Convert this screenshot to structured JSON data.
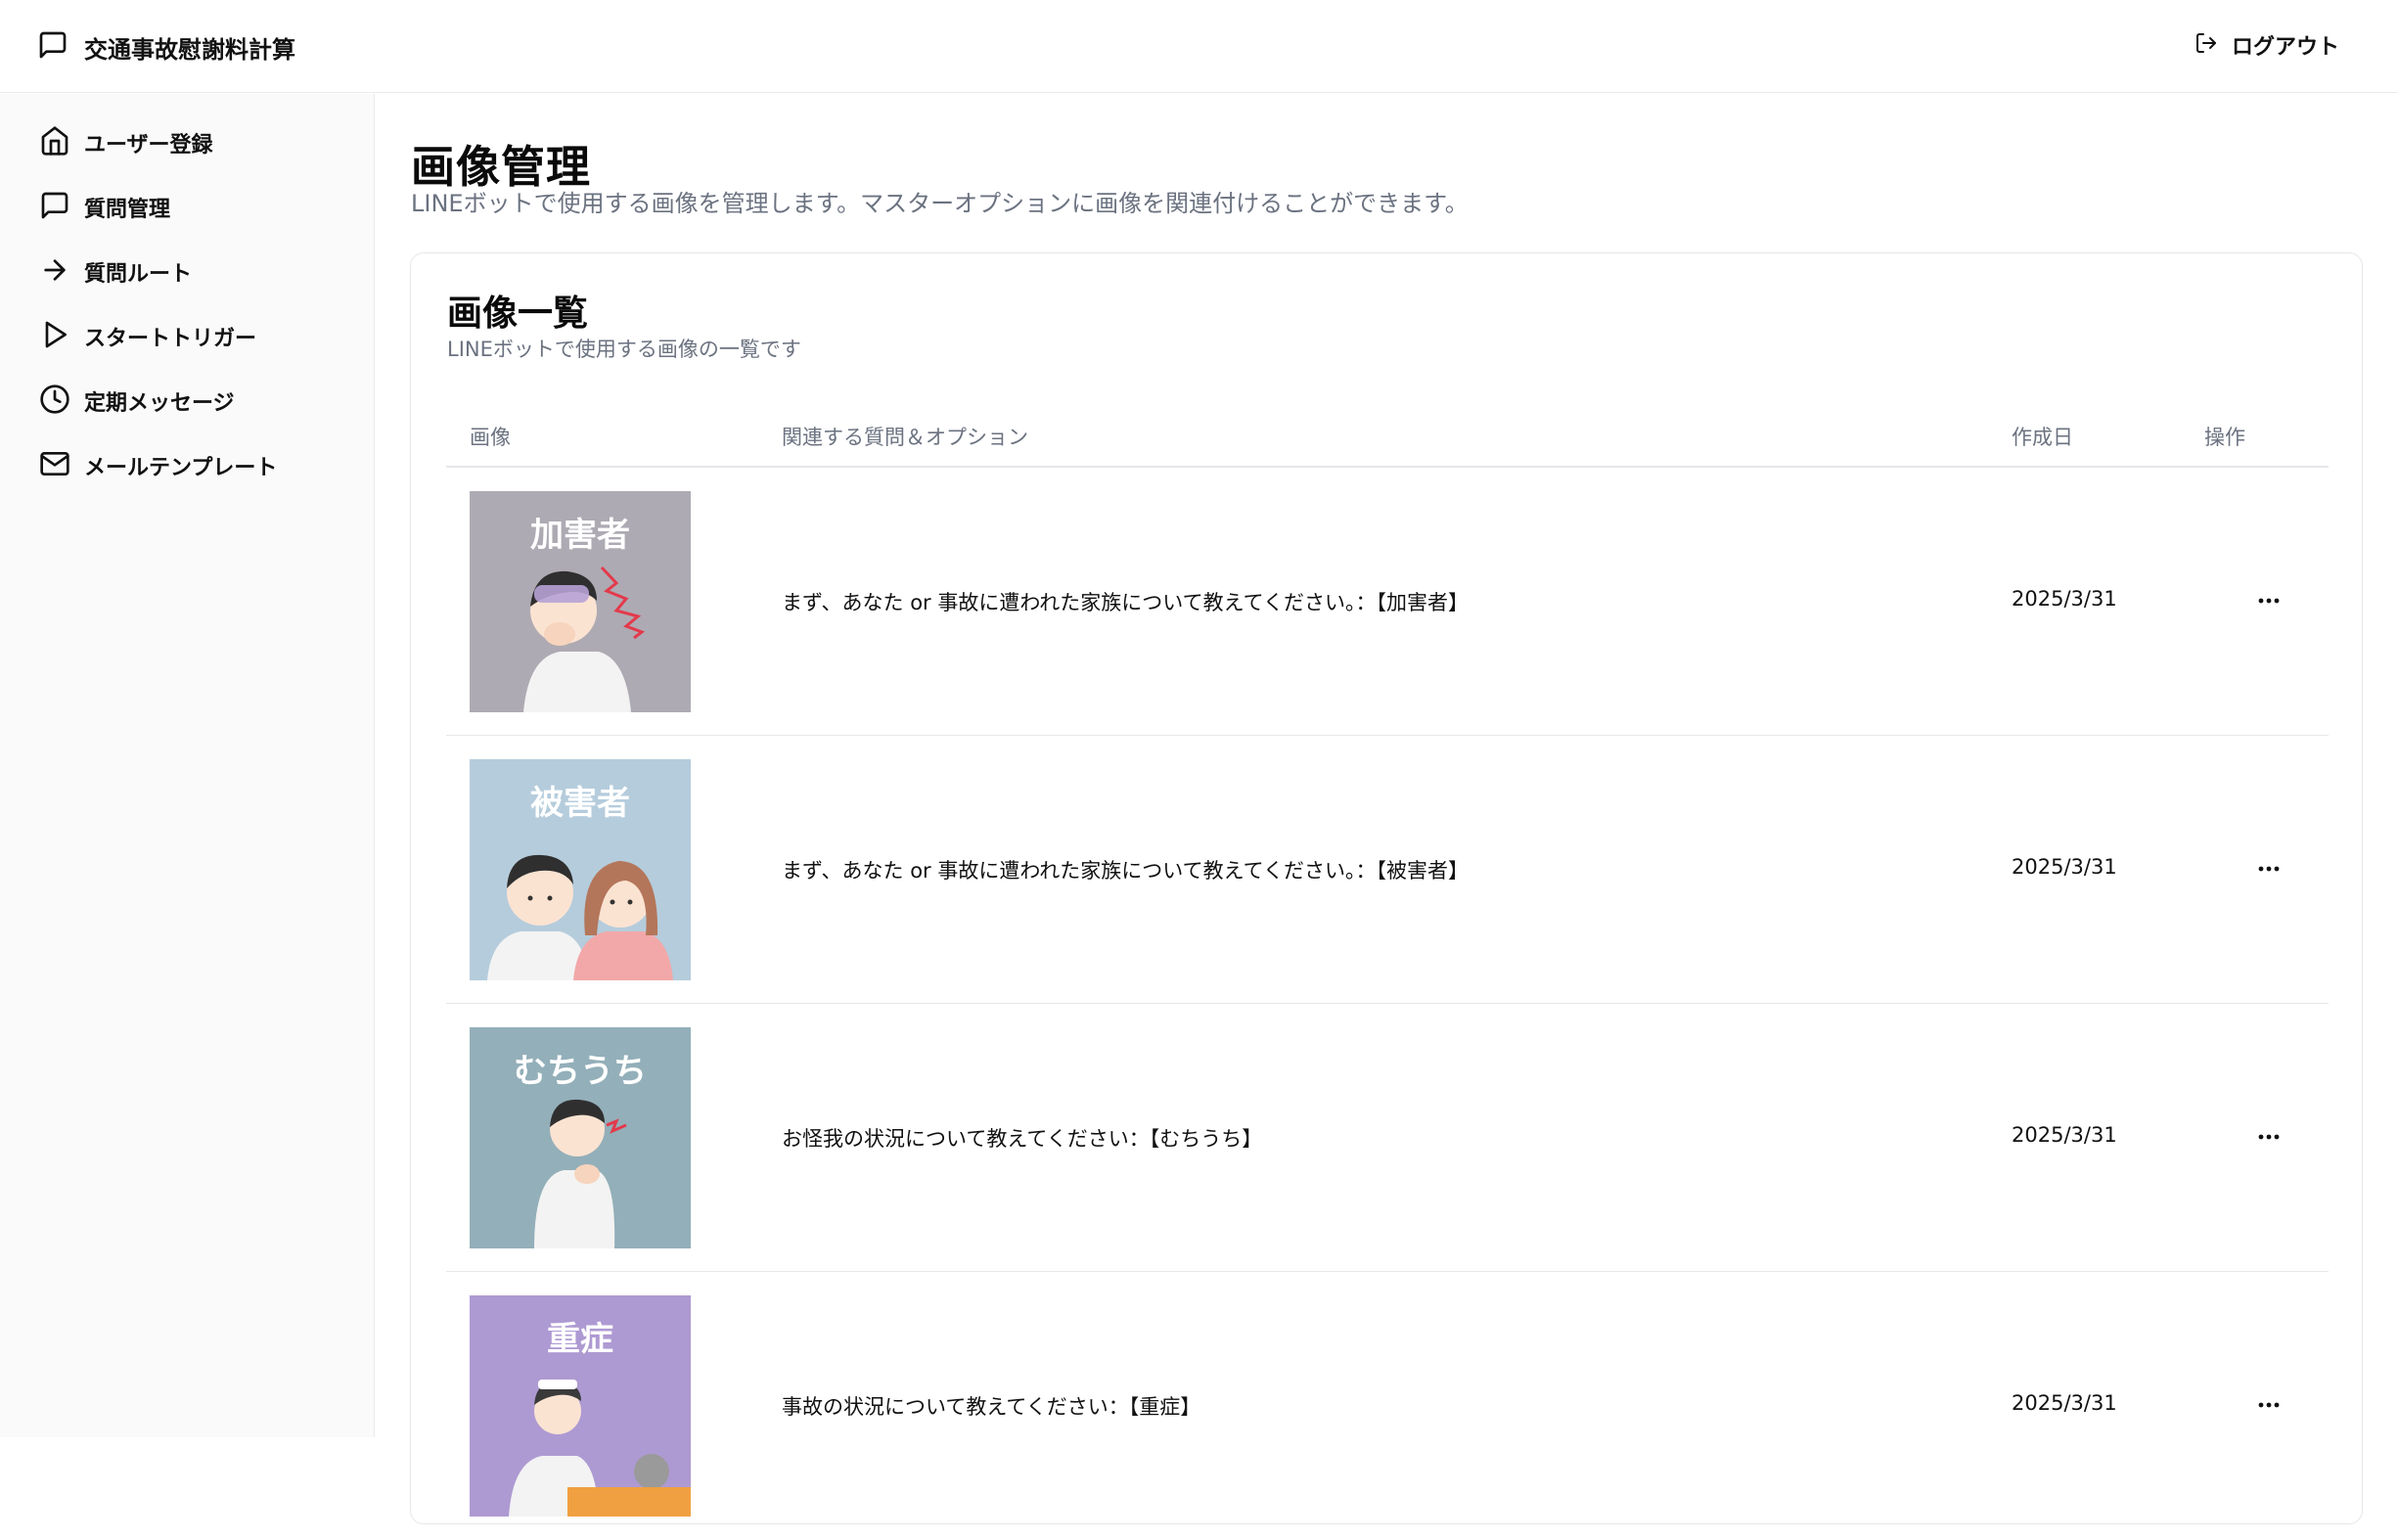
{
  "header": {
    "app_title": "交通事故慰謝料計算",
    "logout_label": "ログアウト"
  },
  "sidebar": {
    "items": [
      {
        "label": "ユーザー登録",
        "icon": "home-icon"
      },
      {
        "label": "質問管理",
        "icon": "message-square-icon"
      },
      {
        "label": "質問ルート",
        "icon": "arrow-right-icon"
      },
      {
        "label": "スタートトリガー",
        "icon": "play-icon"
      },
      {
        "label": "定期メッセージ",
        "icon": "clock-icon"
      },
      {
        "label": "メールテンプレート",
        "icon": "mail-icon"
      }
    ]
  },
  "page": {
    "title": "画像管理",
    "subtitle": "LINEボットで使用する画像を管理します。マスターオプションに画像を関連付けることができます。"
  },
  "card": {
    "title": "画像一覧",
    "subtitle": "LINEボットで使用する画像の一覧です",
    "columns": [
      "画像",
      "関連する質問＆オプション",
      "作成日",
      "操作"
    ],
    "rows": [
      {
        "image_label": "加害者",
        "image_bg": "#aeaab3",
        "question": "まず、あなた or 事故に遭われた家族について教えてください。：【加害者】",
        "date": "2025/3/31"
      },
      {
        "image_label": "被害者",
        "image_bg": "#b5ccdc",
        "question": "まず、あなた or 事故に遭われた家族について教えてください。：【被害者】",
        "date": "2025/3/31"
      },
      {
        "image_label": "むちうち",
        "image_bg": "#93afb9",
        "question": "お怪我の状況について教えてください：【むちうち】",
        "date": "2025/3/31"
      },
      {
        "image_label": "重症",
        "image_bg": "#ae9ad2",
        "question": "事故の状況について教えてください：【重症】",
        "date": "2025/3/31"
      }
    ]
  }
}
